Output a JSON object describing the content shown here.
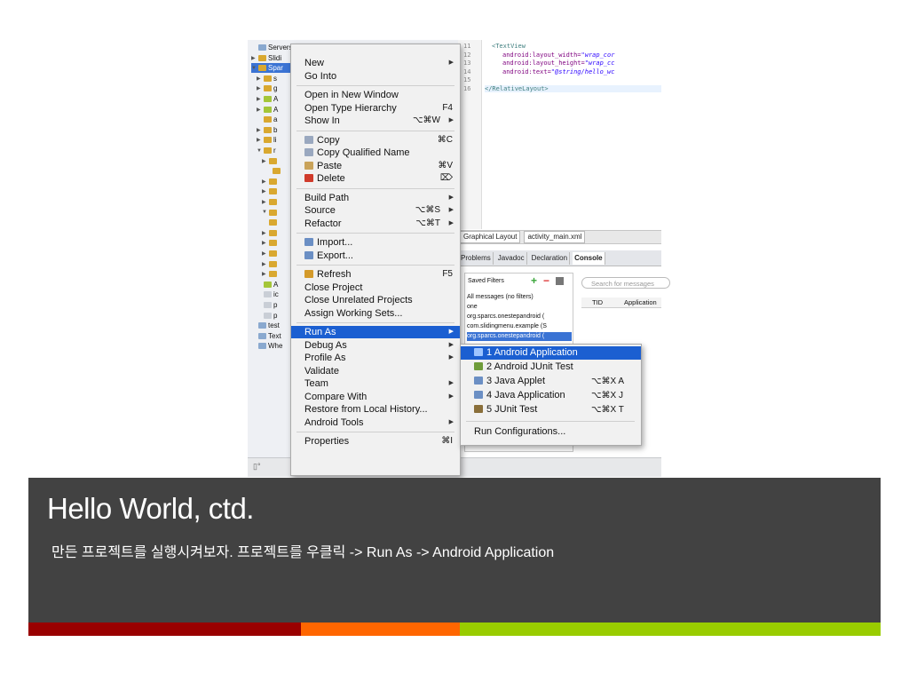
{
  "project_tree": {
    "rows": [
      {
        "label": "Servers",
        "twisty": "",
        "icon": "folder"
      },
      {
        "label": "Slidi",
        "twisty": "▶",
        "icon": "pkg"
      },
      {
        "label": "Spar",
        "twisty": "▼",
        "icon": "pkg",
        "selected": true
      },
      {
        "label": "s",
        "twisty": "▶",
        "icon": "pkg"
      },
      {
        "label": "g",
        "twisty": "▶",
        "icon": "pkg"
      },
      {
        "label": "A",
        "twisty": "▶",
        "icon": "android"
      },
      {
        "label": "A",
        "twisty": "▶",
        "icon": "android"
      },
      {
        "label": "a",
        "twisty": "",
        "icon": "pkg"
      },
      {
        "label": "b",
        "twisty": "▶",
        "icon": "pkg"
      },
      {
        "label": "li",
        "twisty": "▶",
        "icon": "pkg"
      },
      {
        "label": "r",
        "twisty": "▼",
        "icon": "pkg"
      },
      {
        "label": "",
        "twisty": "▶",
        "icon": "pkg"
      },
      {
        "label": "",
        "twisty": "",
        "icon": "pkg"
      },
      {
        "label": "",
        "twisty": "▶",
        "icon": "pkg"
      },
      {
        "label": "",
        "twisty": "▶",
        "icon": "pkg"
      },
      {
        "label": "",
        "twisty": "▶",
        "icon": "pkg"
      },
      {
        "label": "",
        "twisty": "▼",
        "icon": "pkg"
      },
      {
        "label": "",
        "twisty": "",
        "icon": "pkg"
      },
      {
        "label": "",
        "twisty": "▶",
        "icon": "pkg"
      },
      {
        "label": "",
        "twisty": "▶",
        "icon": "pkg"
      },
      {
        "label": "",
        "twisty": "▶",
        "icon": "pkg"
      },
      {
        "label": "",
        "twisty": "▶",
        "icon": "pkg"
      },
      {
        "label": "",
        "twisty": "▶",
        "icon": "pkg"
      },
      {
        "label": "A",
        "twisty": "",
        "icon": "android"
      },
      {
        "label": "ic",
        "twisty": "",
        "icon": "file"
      },
      {
        "label": "p",
        "twisty": "",
        "icon": "file"
      },
      {
        "label": "p",
        "twisty": "",
        "icon": "file"
      },
      {
        "label": "test",
        "twisty": "",
        "icon": "folder"
      },
      {
        "label": "Text",
        "twisty": "",
        "icon": "folder"
      },
      {
        "label": "Whe",
        "twisty": "",
        "icon": "folder"
      }
    ]
  },
  "editor": {
    "line_numbers": [
      "11",
      "12",
      "13",
      "14",
      "15",
      "16"
    ],
    "lines": [
      {
        "tag": "<TextView"
      },
      {
        "attr": "android:layout_width=",
        "val": "\"wrap_cor"
      },
      {
        "attr": "android:layout_height=",
        "val": "\"wrap_cc"
      },
      {
        "attr": "android:text=",
        "val": "\"@string/hello_wc"
      },
      {
        "tag": ""
      },
      {
        "tag": "</RelativeLayout>"
      }
    ],
    "tabs": [
      "Graphical Layout",
      "activity_main.xml"
    ]
  },
  "views": {
    "tabs": [
      "Problems",
      "Javadoc",
      "Declaration",
      "Console"
    ],
    "saved_filters_title": "Saved Filters",
    "filters": [
      "All messages (no filters)",
      "one",
      "org.sparcs.onestepandroid (",
      "com.slidingmenu.example (S",
      "org.sparcs.onestepandroid ("
    ],
    "search_placeholder": "Search for messages",
    "log_headers": [
      "TID",
      "Application"
    ]
  },
  "context_menu": {
    "items": [
      {
        "label": "New",
        "submenu": true
      },
      {
        "label": "Go Into"
      },
      {
        "sep": true
      },
      {
        "label": "Open in New Window"
      },
      {
        "label": "Open Type Hierarchy",
        "shortcut": "F4"
      },
      {
        "label": "Show In",
        "shortcut": "⌥⌘W",
        "submenu": true
      },
      {
        "sep": true
      },
      {
        "label": "Copy",
        "shortcut": "⌘C",
        "icon": "copy-icon"
      },
      {
        "label": "Copy Qualified Name",
        "icon": "copy-qualified-icon"
      },
      {
        "label": "Paste",
        "shortcut": "⌘V",
        "icon": "paste-icon"
      },
      {
        "label": "Delete",
        "shortcut": "⌦",
        "icon": "delete-icon"
      },
      {
        "sep": true
      },
      {
        "label": "Build Path",
        "submenu": true
      },
      {
        "label": "Source",
        "shortcut": "⌥⌘S",
        "submenu": true
      },
      {
        "label": "Refactor",
        "shortcut": "⌥⌘T",
        "submenu": true
      },
      {
        "sep": true
      },
      {
        "label": "Import...",
        "icon": "import-icon"
      },
      {
        "label": "Export...",
        "icon": "export-icon"
      },
      {
        "sep": true
      },
      {
        "label": "Refresh",
        "shortcut": "F5",
        "icon": "refresh-icon"
      },
      {
        "label": "Close Project"
      },
      {
        "label": "Close Unrelated Projects"
      },
      {
        "label": "Assign Working Sets..."
      },
      {
        "sep": true
      },
      {
        "label": "Run As",
        "submenu": true,
        "selected": true
      },
      {
        "label": "Debug As",
        "submenu": true
      },
      {
        "label": "Profile As",
        "submenu": true
      },
      {
        "label": "Validate"
      },
      {
        "label": "Team",
        "submenu": true
      },
      {
        "label": "Compare With",
        "submenu": true
      },
      {
        "label": "Restore from Local History..."
      },
      {
        "label": "Android Tools",
        "submenu": true
      },
      {
        "sep": true
      },
      {
        "label": "Properties",
        "shortcut": "⌘I"
      }
    ]
  },
  "run_as_submenu": {
    "items": [
      {
        "label": "1 Android Application",
        "icon": "android-app-icon",
        "selected": true
      },
      {
        "label": "2 Android JUnit Test",
        "icon": "junit-icon"
      },
      {
        "label": "3 Java Applet",
        "shortcut": "⌥⌘X A",
        "icon": "applet-icon"
      },
      {
        "label": "4 Java Application",
        "shortcut": "⌥⌘X J",
        "icon": "java-app-icon"
      },
      {
        "label": "5 JUnit Test",
        "shortcut": "⌥⌘X T",
        "icon": "junit-test-icon"
      },
      {
        "sep": true
      },
      {
        "label": "Run Configurations..."
      }
    ]
  },
  "slide": {
    "title": "Hello World, ctd.",
    "subtitle": "만든 프로젝트를 실행시켜보자. 프로젝트를 우클릭 -> Run As -> Android Application"
  },
  "colors": {
    "banner": "#424242",
    "bar_red": "#990000",
    "bar_orange": "#ff6600",
    "bar_green": "#99cc00",
    "menu_selection": "#1b5fd1"
  }
}
